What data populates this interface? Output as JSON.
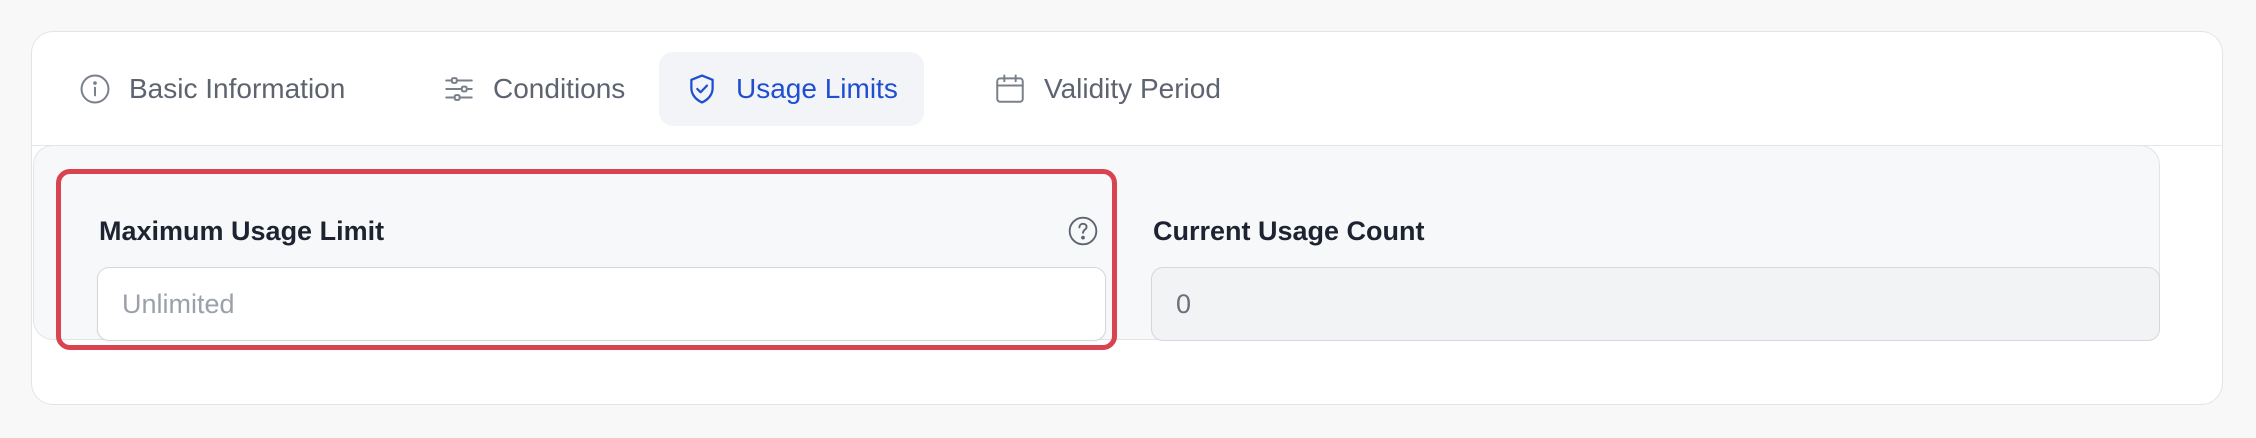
{
  "tabs": [
    {
      "label": "Basic Information",
      "icon": "info-circle-icon",
      "active": false
    },
    {
      "label": "Conditions",
      "icon": "sliders-icon",
      "active": false
    },
    {
      "label": "Usage Limits",
      "icon": "shield-check-icon",
      "active": true
    },
    {
      "label": "Validity Period",
      "icon": "calendar-icon",
      "active": false
    }
  ],
  "fields": {
    "max_usage": {
      "label": "Maximum Usage Limit",
      "placeholder": "Unlimited",
      "value": "",
      "help_icon": "question-circle-icon"
    },
    "current_usage": {
      "label": "Current Usage Count",
      "value": "0"
    }
  },
  "colors": {
    "accent": "#1f4fd1",
    "highlight": "#d9434f"
  }
}
